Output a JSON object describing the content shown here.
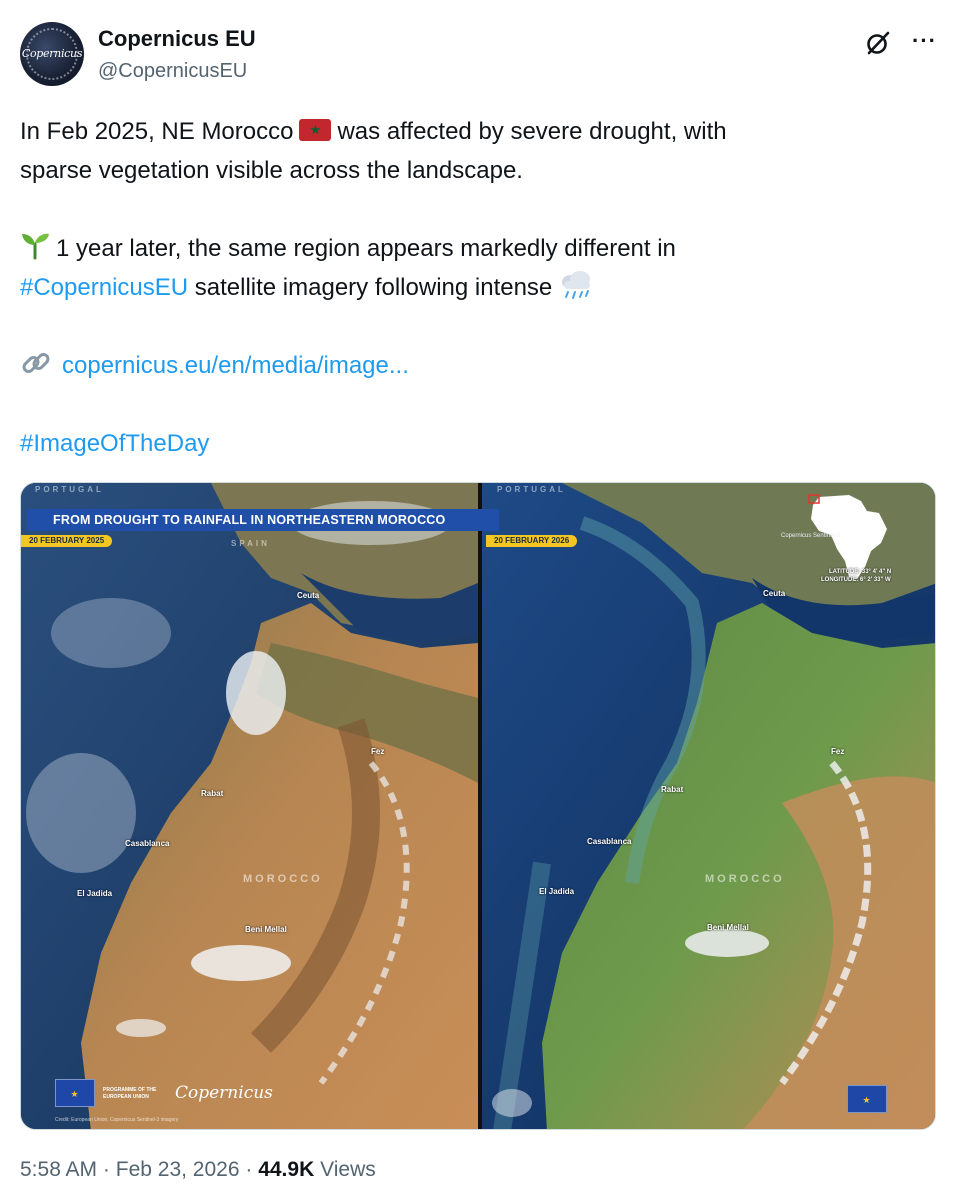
{
  "account": {
    "display_name": "Copernicus EU",
    "handle": "@CopernicusEU",
    "avatar_text": "Copernicus"
  },
  "tweet": {
    "line1_a": "In Feb 2025, NE Morocco",
    "line1_b": "was affected by severe drought, with",
    "line2": "sparse vegetation visible across the landscape.",
    "line3": "1 year later, the same region appears markedly different in",
    "line4_hashtag": "#CopernicusEU",
    "line4_rest": "satellite imagery following  intense",
    "link": "copernicus.eu/en/media/image...",
    "hashtag_day": "#ImageOfTheDay"
  },
  "icons": {
    "flag": "morocco-flag-icon",
    "sprout": "seedling-icon",
    "rain": "rain-cloud-icon",
    "link": "link-icon",
    "grok": "grok-icon",
    "more": "more-icon"
  },
  "media": {
    "banner": "FROM DROUGHT TO RAINFALL IN NORTHEASTERN MOROCCO",
    "date_left": "20 FEBRUARY 2025",
    "date_right": "20 FEBRUARY 2026",
    "portugal": "PORTUGAL",
    "spain": "SPAIN",
    "morocco": "MOROCCO",
    "cities": {
      "ceuta": "Ceuta",
      "fez": "Fez",
      "rabat": "Rabat",
      "casablanca": "Casablanca",
      "el_jadida": "El Jadida",
      "beni_mellal": "Beni Mellal"
    },
    "sentinel": "Copernicus Sentinel-3",
    "latitude": "LATITUDE: 33° 4' 4\" N",
    "longitude": "LONGITUDE: 6° 2' 33\" W",
    "programme": "PROGRAMME OF THE\nEUROPEAN UNION",
    "copernicus_logo": "Copernicus",
    "credit": "Credit: European Union, Copernicus Sentinel-3 imagery"
  },
  "colors": {
    "link": "#1d9bf0",
    "banner": "#1f4fa8",
    "date_tag": "#f3c623"
  },
  "footer": {
    "time": "5:58 AM",
    "date": "Feb 23, 2026",
    "views_count": "44.9K",
    "views_label": "Views",
    "separator": "·"
  }
}
